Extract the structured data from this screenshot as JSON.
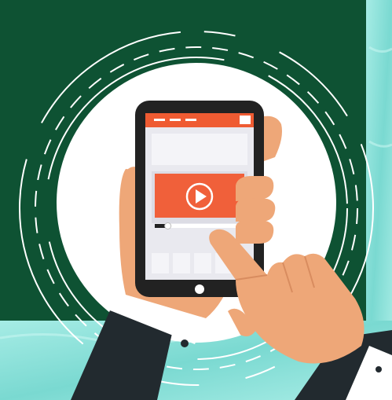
{
  "scene": {
    "description_label": "",
    "colors": {
      "background_green": "#0e5233",
      "water_teal": "#8fe3dc",
      "circle_white": "#ffffff",
      "phone_body": "#222222",
      "screen_bg": "#e9e9ef",
      "header_orange": "#ef5b32",
      "video_orange": "#f0603a",
      "skin": "#eea778",
      "suit": "#222a2f",
      "cuff": "#ffffff"
    },
    "icons": {
      "play": "play-icon",
      "home_button": "home-button-icon"
    },
    "video": {
      "progress": 0.12
    }
  }
}
